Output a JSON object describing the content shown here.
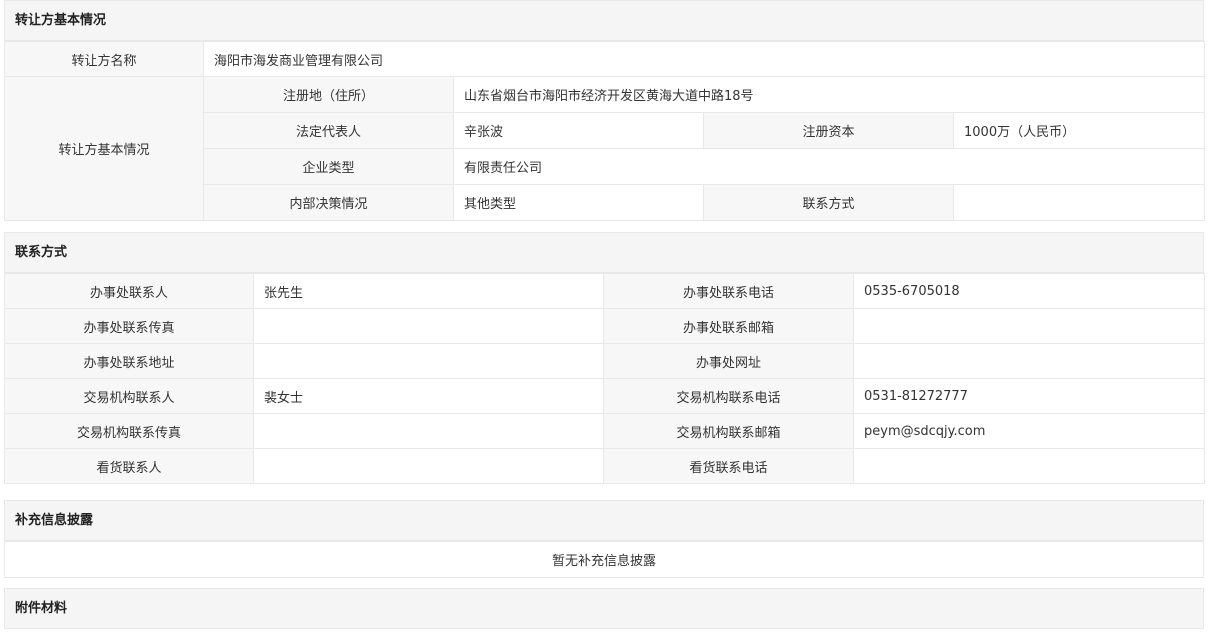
{
  "transferor": {
    "section_title": "转让方基本情况",
    "name_label": "转让方名称",
    "name_value": "海阳市海发商业管理有限公司",
    "basic_label": "转让方基本情况",
    "address_label": "注册地（住所）",
    "address_value": "山东省烟台市海阳市经济开发区黄海大道中路18号",
    "legal_rep_label": "法定代表人",
    "legal_rep_value": "辛张波",
    "capital_label": "注册资本",
    "capital_value": "1000万（人民币）",
    "company_type_label": "企业类型",
    "company_type_value": "有限责任公司",
    "decision_label": "内部决策情况",
    "decision_value": "其他类型",
    "contact_label": "联系方式",
    "contact_value": ""
  },
  "contact": {
    "section_title": "联系方式",
    "rows": [
      {
        "l1": "办事处联系人",
        "v1": "张先生",
        "l2": "办事处联系电话",
        "v2": "0535-6705018"
      },
      {
        "l1": "办事处联系传真",
        "v1": "",
        "l2": "办事处联系邮箱",
        "v2": ""
      },
      {
        "l1": "办事处联系地址",
        "v1": "",
        "l2": "办事处网址",
        "v2": ""
      },
      {
        "l1": "交易机构联系人",
        "v1": "裴女士",
        "l2": "交易机构联系电话",
        "v2": "0531-81272777"
      },
      {
        "l1": "交易机构联系传真",
        "v1": "",
        "l2": "交易机构联系邮箱",
        "v2": "peym@sdcqjy.com"
      },
      {
        "l1": "看货联系人",
        "v1": "",
        "l2": "看货联系电话",
        "v2": ""
      }
    ]
  },
  "supplement": {
    "section_title": "补充信息披露",
    "empty_text": "暂无补充信息披露"
  },
  "attachments": {
    "section_title": "附件材料"
  }
}
